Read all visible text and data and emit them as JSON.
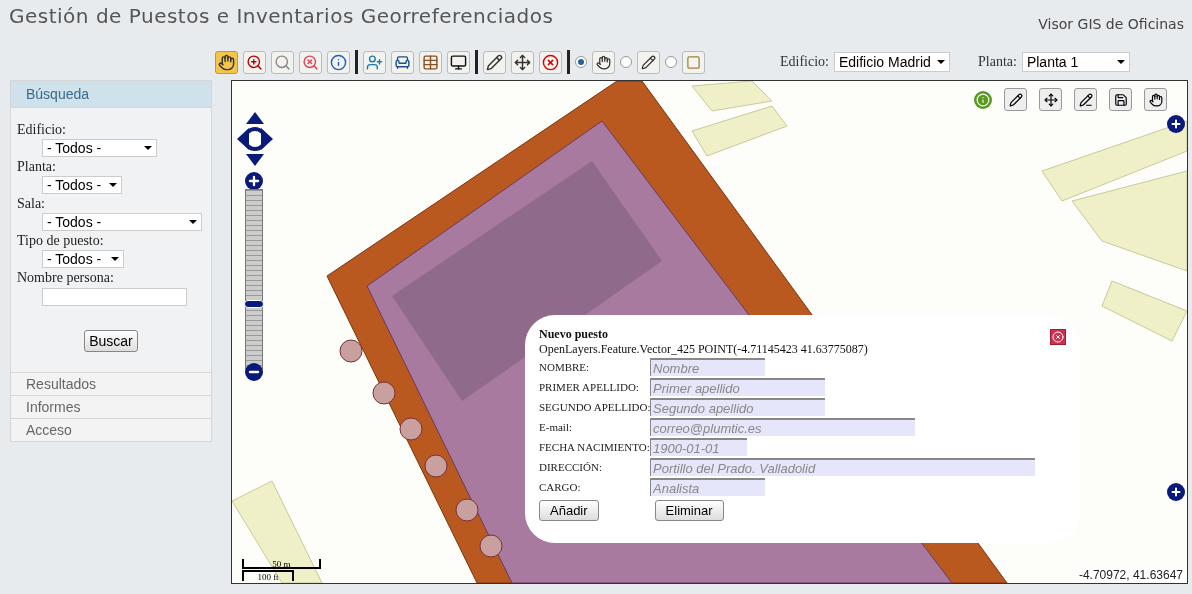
{
  "header": {
    "title": "Gestión de Puestos e Inventarios Georreferenciados",
    "subtitle": "Visor GIS de Oficinas"
  },
  "toolbar": {
    "tools": [
      {
        "kind": "tool",
        "selected": true
      },
      {
        "kind": "tool",
        "selected": false
      },
      {
        "kind": "tool",
        "selected": false
      },
      {
        "kind": "tool",
        "selected": false
      },
      {
        "kind": "tool",
        "selected": false
      },
      {
        "kind": "separator"
      },
      {
        "kind": "tool",
        "selected": false
      },
      {
        "kind": "tool",
        "selected": false
      },
      {
        "kind": "tool",
        "selected": false
      },
      {
        "kind": "tool",
        "selected": false
      },
      {
        "kind": "separator"
      },
      {
        "kind": "tool",
        "selected": false
      },
      {
        "kind": "tool",
        "selected": false
      },
      {
        "kind": "tool",
        "selected": false
      },
      {
        "kind": "separator"
      },
      {
        "kind": "radio",
        "selected": true
      },
      {
        "kind": "radio",
        "selected": false
      },
      {
        "kind": "radio",
        "selected": false
      }
    ],
    "selects": [
      {
        "label": "Edificio:",
        "value": "Edificio Madrid"
      },
      {
        "label": "Planta:",
        "value": "Planta 1"
      }
    ]
  },
  "sidebar": {
    "sections": [
      {
        "title": "Búsqueda",
        "expanded": true,
        "fields": [
          {
            "kind": "select",
            "label": "Edificio:",
            "value": "- Todos -"
          },
          {
            "kind": "select",
            "label": "Planta:",
            "value": "- Todos -"
          },
          {
            "kind": "select",
            "label": "Sala:",
            "value": "- Todos -"
          },
          {
            "kind": "select",
            "label": "Tipo de puesto:",
            "value": "- Todos -"
          },
          {
            "kind": "text",
            "label": "Nombre persona:"
          }
        ],
        "button": "Buscar"
      },
      {
        "title": "Resultados",
        "expanded": false
      },
      {
        "title": "Informes",
        "expanded": false
      },
      {
        "title": "Acceso",
        "expanded": false
      }
    ]
  },
  "map": {
    "zoom": {
      "level": 0.36
    },
    "scale": {
      "top": "50 m",
      "bottom": "100 ft"
    },
    "coordinates": "-4.70972, 41.63647",
    "popup": {
      "title": "Nuevo puesto",
      "subtitle": "OpenLayers.Feature.Vector_425 POINT(-4.71145423 41.63775087)",
      "fields": [
        {
          "label": "NOMBRE:",
          "placeholder": "Nombre"
        },
        {
          "label": "PRIMER APELLIDO:",
          "placeholder": "Primer apellido"
        },
        {
          "label": "SEGUNDO APELLIDO:",
          "placeholder": "Segundo apellido"
        },
        {
          "label": "E-mail:",
          "placeholder": "correo@plumtic.es"
        },
        {
          "label": "FECHA NACIMIENTO:",
          "placeholder": "1900-01-01"
        },
        {
          "label": "DIRECCIÓN:",
          "placeholder": "Portillo del Prado. Valladolid"
        },
        {
          "label": "CARGO:",
          "placeholder": "Analista"
        }
      ],
      "buttons": [
        "Añadir",
        "Eliminar"
      ]
    }
  }
}
